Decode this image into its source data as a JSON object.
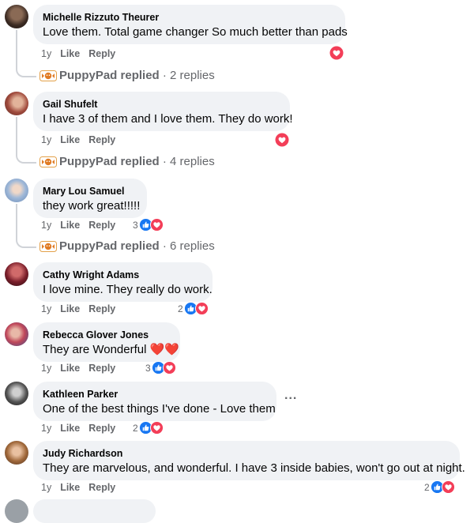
{
  "comments": [
    {
      "name": "Michelle Rizzuto Theurer",
      "text": "Love them. Total game changer So much better than pads",
      "time": "1y",
      "like": "Like",
      "reply": "Reply",
      "reactions": "",
      "reaction_types": [
        "love"
      ]
    },
    {
      "name": "Gail Shufelt",
      "text": "I have 3 of them and I love them. They do work!",
      "time": "1y",
      "like": "Like",
      "reply": "Reply",
      "reactions": "",
      "reaction_types": [
        "love"
      ]
    },
    {
      "name": "Mary Lou Samuel",
      "text": "they work great!!!!!",
      "time": "1y",
      "like": "Like",
      "reply": "Reply",
      "reactions": "3",
      "reaction_types": [
        "like",
        "love"
      ]
    },
    {
      "name": "Cathy Wright Adams",
      "text": "I love mine. They really do work.",
      "time": "1y",
      "like": "Like",
      "reply": "Reply",
      "reactions": "2",
      "reaction_types": [
        "like",
        "love"
      ]
    },
    {
      "name": "Rebecca Glover Jones",
      "text": "They are Wonderful ❤️❤️",
      "time": "1y",
      "like": "Like",
      "reply": "Reply",
      "reactions": "3",
      "reaction_types": [
        "like",
        "love"
      ]
    },
    {
      "name": "Kathleen Parker",
      "text": "One of the best things I've done - Love them",
      "time": "1y",
      "like": "Like",
      "reply": "Reply",
      "reactions": "2",
      "reaction_types": [
        "like",
        "love"
      ],
      "more": "..."
    },
    {
      "name": "Judy Richardson",
      "text": "They are marvelous, and wonderful. I have 3 inside babies, won't go out at night.",
      "time": "1y",
      "like": "Like",
      "reply": "Reply",
      "reactions": "2",
      "reaction_types": [
        "like",
        "love"
      ]
    }
  ],
  "replies": [
    {
      "name": "PuppyPad replied",
      "rest": " · 2 replies"
    },
    {
      "name": "PuppyPad replied",
      "rest": " · 4 replies"
    },
    {
      "name": "PuppyPad replied",
      "rest": " · 6 replies"
    }
  ],
  "colors": {
    "like_blue": "#1877f2",
    "love_red": "#f33e58",
    "bubble": "#f0f2f5",
    "meta": "#65676b"
  },
  "icons": {
    "like": "thumbs-up-icon",
    "love": "heart-icon",
    "page_logo": "puppypad-logo-icon"
  }
}
